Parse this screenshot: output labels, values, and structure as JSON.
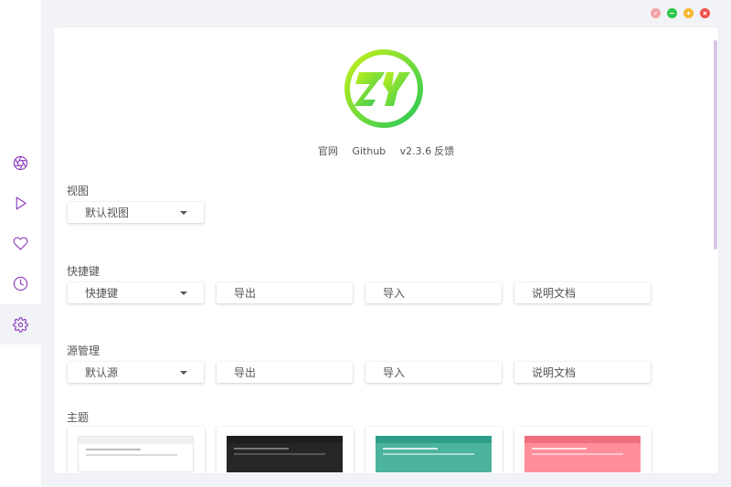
{
  "sidebar": {
    "items": [
      {
        "name": "aperture-icon",
        "active": false
      },
      {
        "name": "play-icon",
        "active": false
      },
      {
        "name": "heart-icon",
        "active": false
      },
      {
        "name": "clock-icon",
        "active": false
      },
      {
        "name": "gear-icon",
        "active": true
      }
    ],
    "icon_color": "#8a3bbf"
  },
  "window_controls": {
    "pin_color": "#f2a4a8",
    "minimize_color": "#2ec84a",
    "maximize_color": "#f6b731",
    "close_color": "#f0504a"
  },
  "logo": {
    "text": "ZY",
    "gradient": [
      "#b8ee1c",
      "#2fcc54"
    ]
  },
  "links": {
    "website": "官网",
    "github": "Github",
    "version": "v2.3.6",
    "feedback": "反馈"
  },
  "view": {
    "title": "视图",
    "select_value": "默认视图"
  },
  "shortcuts": {
    "title": "快捷键",
    "select_value": "快捷键",
    "export": "导出",
    "import": "导入",
    "docs": "说明文档"
  },
  "sources": {
    "title": "源管理",
    "select_value": "默认源",
    "export": "导出",
    "import": "导入",
    "docs": "说明文档"
  },
  "theme": {
    "title": "主题",
    "cards": [
      {
        "name": "light",
        "bar": "#f0f0f0",
        "bg": "#ffffff",
        "row": "#bdbdbd"
      },
      {
        "name": "dark",
        "bar": "#1e1e1e",
        "bg": "#262626",
        "row": "#777777"
      },
      {
        "name": "green",
        "bar": "#2f9f8a",
        "bg": "#4cb39e",
        "row": "#d8efe9"
      },
      {
        "name": "pink",
        "bar": "#f0707e",
        "bg": "#ff8e9a",
        "row": "#ffe3e6"
      }
    ]
  }
}
